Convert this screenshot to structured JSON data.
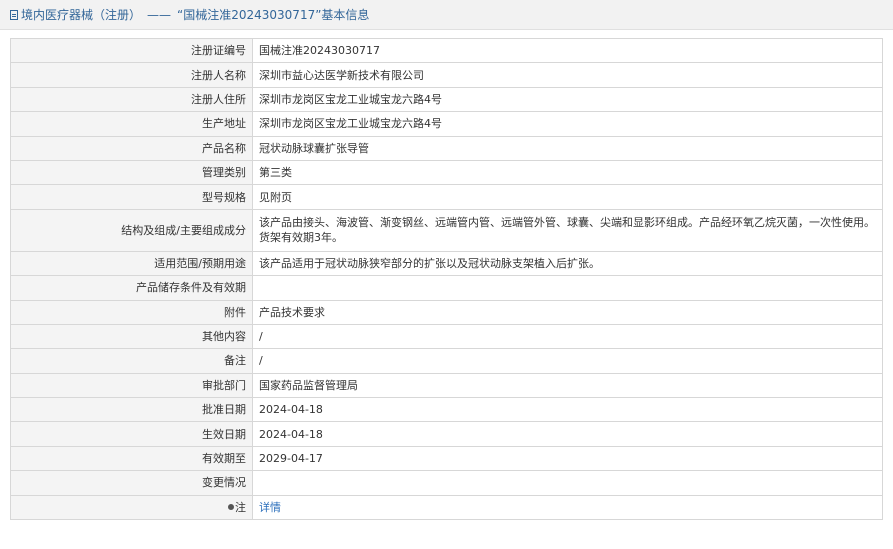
{
  "header": {
    "category": "境内医疗器械（注册）",
    "separator": "——",
    "title": "“国械注准20243030717”基本信息"
  },
  "rows": [
    {
      "label": "注册证编号",
      "value": "国械注准20243030717"
    },
    {
      "label": "注册人名称",
      "value": "深圳市益心达医学新技术有限公司"
    },
    {
      "label": "注册人住所",
      "value": "深圳市龙岗区宝龙工业城宝龙六路4号"
    },
    {
      "label": "生产地址",
      "value": "深圳市龙岗区宝龙工业城宝龙六路4号"
    },
    {
      "label": "产品名称",
      "value": "冠状动脉球囊扩张导管"
    },
    {
      "label": "管理类别",
      "value": "第三类"
    },
    {
      "label": "型号规格",
      "value": "见附页"
    },
    {
      "label": "结构及组成/主要组成成分",
      "value": "该产品由接头、海波管、渐变钢丝、远端管内管、远端管外管、球囊、尖端和显影环组成。产品经环氧乙烷灭菌，一次性使用。货架有效期3年。"
    },
    {
      "label": "适用范围/预期用途",
      "value": "该产品适用于冠状动脉狭窄部分的扩张以及冠状动脉支架植入后扩张。"
    },
    {
      "label": "产品储存条件及有效期",
      "value": ""
    },
    {
      "label": "附件",
      "value": "产品技术要求"
    },
    {
      "label": "其他内容",
      "value": "/"
    },
    {
      "label": "备注",
      "value": "/"
    },
    {
      "label": "审批部门",
      "value": "国家药品监督管理局"
    },
    {
      "label": "批准日期",
      "value": "2024-04-18"
    },
    {
      "label": "生效日期",
      "value": "2024-04-18"
    },
    {
      "label": "有效期至",
      "value": "2029-04-17"
    },
    {
      "label": "变更情况",
      "value": ""
    }
  ],
  "note": {
    "label": "注",
    "link": "详情",
    "icon": "pin-icon"
  }
}
